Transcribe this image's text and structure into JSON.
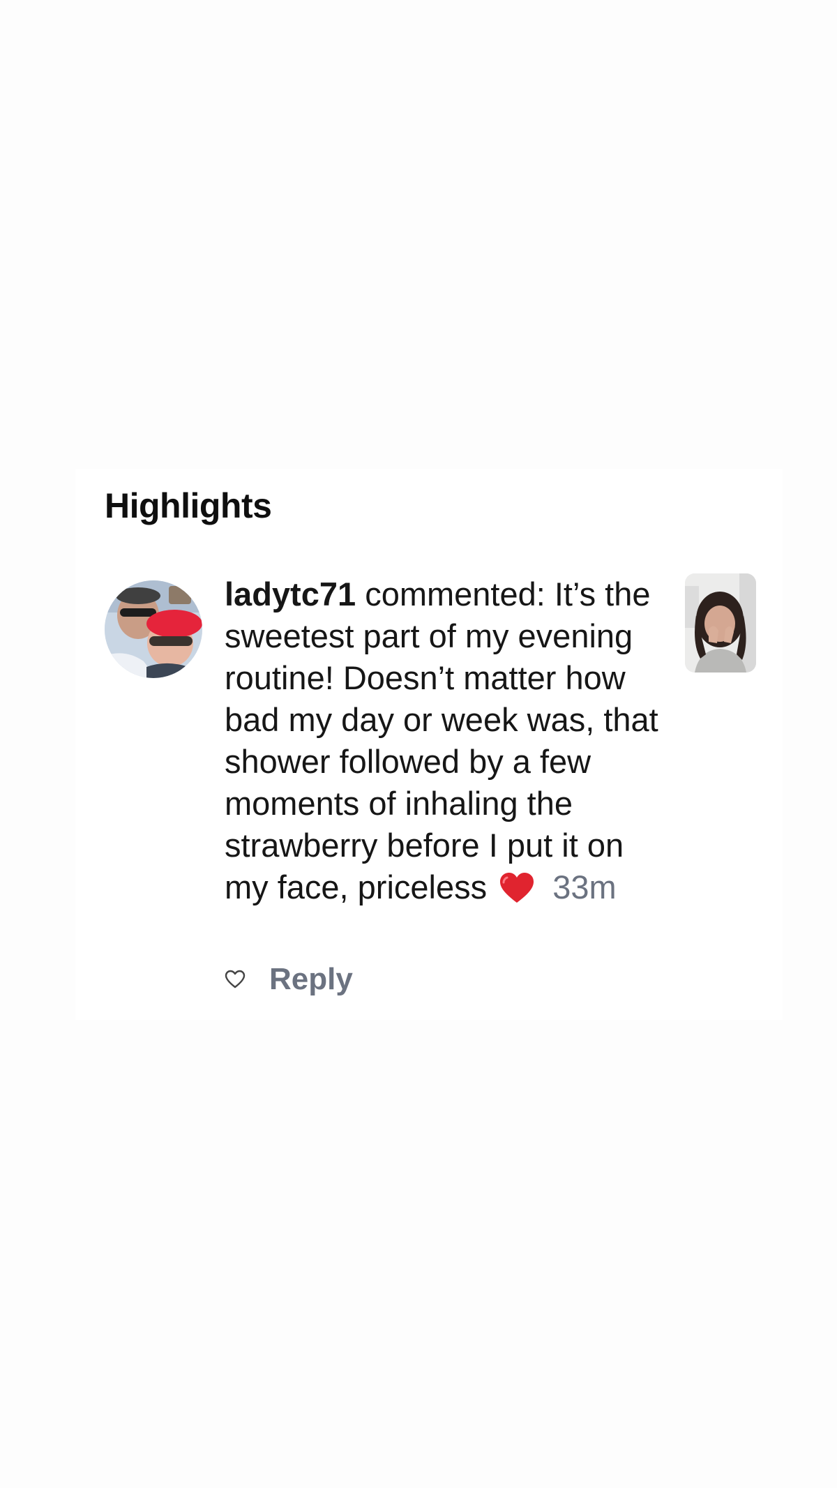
{
  "highlights": {
    "title": "Highlights"
  },
  "comment": {
    "username": "ladytc71",
    "action_text": "commented:",
    "body": "It’s the sweetest part of my evening routine! Doesn’t matter how bad my day or week was, that shower followed by a few moments of inhaling the strawberry before I put it on my face, priceless",
    "emoji": "red-heart-emoji",
    "time": "33m",
    "avatar": "avatar",
    "thumbnail": "post-thumbnail"
  },
  "actions": {
    "like_icon": "heart-outline-icon",
    "reply_label": "Reply"
  },
  "colors": {
    "background": "#fdfdfd",
    "card": "#ffffff",
    "text": "#161616",
    "muted": "#6b7280",
    "heart": "#e0242f"
  }
}
